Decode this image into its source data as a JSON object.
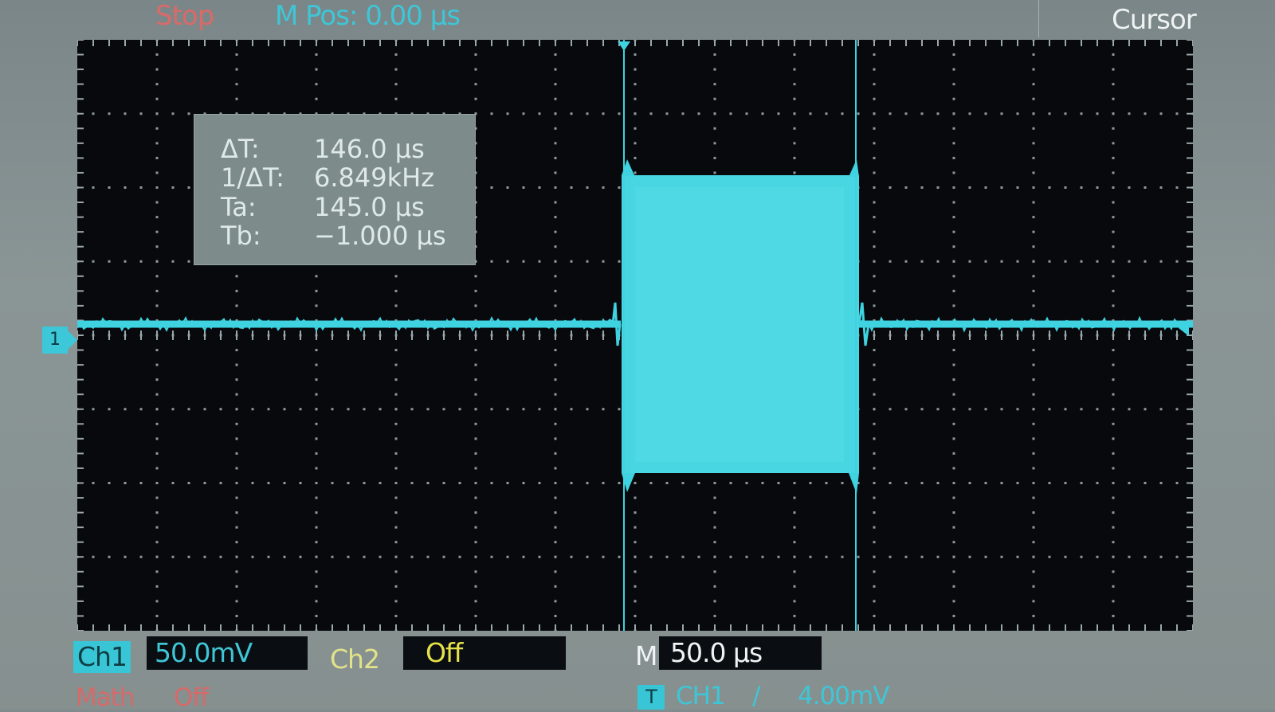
{
  "header": {
    "status": "Stop",
    "m_pos": "M Pos: 0.00 µs",
    "menu_title": "Cursor"
  },
  "cursor_readout": {
    "delta_t_label": "ΔT:",
    "delta_t_value": "146.0 µs",
    "inv_delta_t_label": "1/ΔT:",
    "inv_delta_t_value": "6.849kHz",
    "ta_label": "Ta:",
    "ta_value": "145.0 µs",
    "tb_label": "Tb:",
    "tb_value": "−1.000 µs"
  },
  "channel_marker": "1",
  "footer": {
    "ch1_label": "Ch1",
    "ch1_scale": "50.0mV",
    "ch2_label": "Ch2",
    "ch2_scale": "Off",
    "timebase_label": "M",
    "timebase_scale": "50.0 µs",
    "math_label": "Math",
    "math_state": "Off",
    "trigger_tag": "T",
    "trigger_source": "CH1",
    "trigger_slope": "/",
    "trigger_level": "4.00mV"
  },
  "colors": {
    "trace": "#3fd2e0",
    "status": "#d96a6a",
    "ch2": "#e6e24a"
  }
}
